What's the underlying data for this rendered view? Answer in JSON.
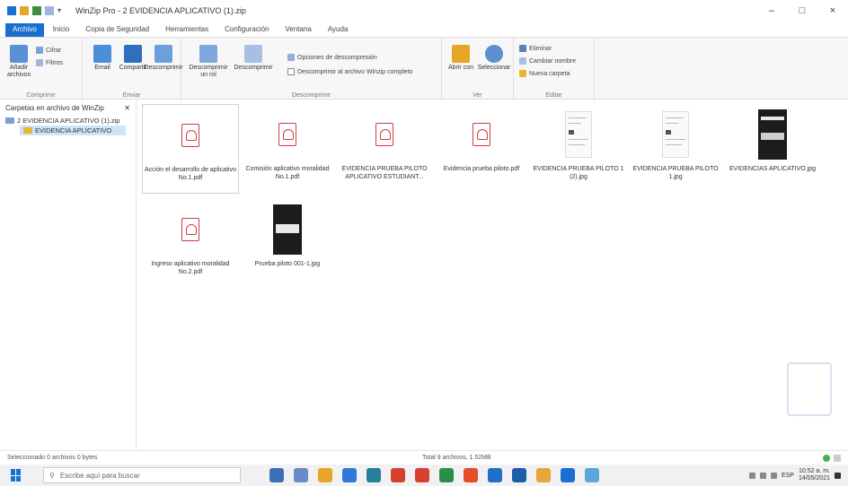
{
  "window": {
    "title": "WinZip Pro - 2 EVIDENCIA APLICATIVO (1).zip",
    "controls": [
      "–",
      "□",
      "×"
    ]
  },
  "tabs": [
    {
      "label": "Archivo",
      "active": true
    },
    {
      "label": "Inicio",
      "active": false
    },
    {
      "label": "Copia de Seguridad",
      "active": false
    },
    {
      "label": "Herramientas",
      "active": false
    },
    {
      "label": "Configuración",
      "active": false
    },
    {
      "label": "Ventana",
      "active": false
    },
    {
      "label": "Ayuda",
      "active": false
    }
  ],
  "ribbon": {
    "groups": [
      {
        "label": "Comprimir"
      },
      {
        "label": "Enviar"
      },
      {
        "label": "Descomprimir"
      },
      {
        "label": "Ver"
      },
      {
        "label": "Editar"
      }
    ],
    "buttons": {
      "add_files": "Añadir archivos",
      "cifrar": "Cifrar",
      "filtros": "Filtros",
      "email": "Email",
      "share": "Compartir",
      "unzip_to": "Descomprimir",
      "unzip_compare": "Descomprimir un rol",
      "unzip_one": "Descomprimir",
      "options": "Opciones de descompresión",
      "unzip_open": "Descomprimir al archivo Winzip completo",
      "view": "Abrir con",
      "select": "Seleccionar",
      "delete": "Eliminar",
      "rename": "Cambiar nombre",
      "new_folder": "Nueva carpeta"
    }
  },
  "nav": {
    "header": "Carpetas en archivo de WinZip",
    "pin": "✕",
    "items": [
      {
        "label": "2 EVIDENCIA APLICATIVO (1).zip",
        "selected": false
      },
      {
        "label": "EVIDENCIA APLICATIVO",
        "selected": true
      }
    ]
  },
  "files": [
    {
      "name": "Acción el desarrollo de aplicativo No.1.pdf",
      "kind": "pdf",
      "selected": true
    },
    {
      "name": "Comisión aplicativo moralidad No.1.pdf",
      "kind": "pdf",
      "selected": false
    },
    {
      "name": "EVIDENCIA PRUEBA PILOTO APLICATIVO ESTUDIANT...",
      "kind": "pdf",
      "selected": false
    },
    {
      "name": "Evidencia prueba piloto.pdf",
      "kind": "pdf",
      "selected": false
    },
    {
      "name": "EVIDENCIA PRUEBA PILOTO 1 (2).jpg",
      "kind": "doc",
      "selected": false
    },
    {
      "name": "EVIDENCIA PRUEBA PILOTO 1.jpg",
      "kind": "doc",
      "selected": false
    },
    {
      "name": "EVIDENCIAS APLICATIVO.jpg",
      "kind": "photo",
      "selected": false
    },
    {
      "name": "Ingreso aplicativo moralidad No.2.pdf",
      "kind": "pdf",
      "selected": false
    },
    {
      "name": "Prueba piloto 001-1.jpg",
      "kind": "photo",
      "selected": false
    }
  ],
  "status": {
    "left": "Seleccionado 0 archivos 0 bytes",
    "middle": "Total 9 archivos, 1.52MB"
  },
  "taskbar": {
    "search_placeholder": "Escribe aquí para buscar",
    "search_icon": "search-icon",
    "apps": [
      "#3d6fb6",
      "#6a8bc7",
      "#e6a627",
      "#2f7ad6",
      "#25809d",
      "#d6402e",
      "#d6402e",
      "#2b8f4a",
      "#e44d26",
      "#1f6fc5",
      "#1b5fa8",
      "#e8a53b",
      "#1a6fd0",
      "#5aa6d9"
    ],
    "tray_lang": "ESP",
    "time": "10:52 a. m.",
    "date": "14/05/2021"
  }
}
